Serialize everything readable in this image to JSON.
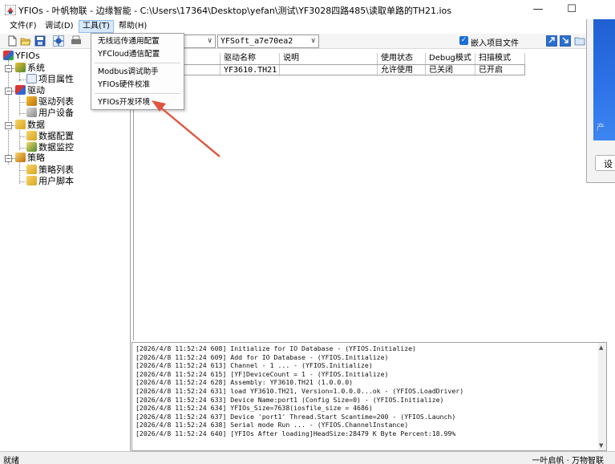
{
  "window": {
    "title": "YFIOs - 叶帆物联 - 边缘智能 - C:\\Users\\17364\\Desktop\\yefan\\测试\\YF3028四路485\\读取单路的TH21.ios",
    "minimize": "—",
    "maximize": "☐",
    "close": "✕"
  },
  "menubar": {
    "file": "文件(F)",
    "debug": "调试(D)",
    "tools": "工具(T)",
    "help": "帮助(H)"
  },
  "tools_menu": {
    "items": [
      "无线远传通用配置",
      "YFCloud通信配置",
      "Modbus调试助手",
      "YFIOs硬件校准",
      "YFIOs开发环境"
    ]
  },
  "toolbar": {
    "combo1": "",
    "combo2": "YFSoft_a7e70ea2",
    "embed_label": "嵌入项目文件",
    "embed_checked": true
  },
  "tree": {
    "root": "YFIOs",
    "system": "系统",
    "project_props": "项目属性",
    "drivers": "驱动",
    "driver_list": "驱动列表",
    "user_devices": "用户设备",
    "data": "数据",
    "data_config": "数据配置",
    "data_monitor": "数据监控",
    "strategy": "策略",
    "strategy_list": "策略列表",
    "user_script": "用户脚本"
  },
  "grid": {
    "columns": [
      "",
      "驱动名称",
      "说明",
      "使用状态",
      "Debug模式",
      "扫描模式"
    ],
    "rows": [
      [
        "",
        "YF3610.TH21",
        "",
        "允许使用",
        "已关闭",
        "已开启"
      ]
    ]
  },
  "log": [
    "[2026/4/8 11:52:24 608] Initialize for IO Database - (YFIOS.Initialize)",
    "[2026/4/8 11:52:24 609] Add for IO Database - (YFIOS.Initialize)",
    "[2026/4/8 11:52:24 613] Channel - 1 ... - (YFIOS.Initialize)",
    "[2026/4/8 11:52:24 615] [YF]DeviceCount = 1 - (YFIOS.Initialize)",
    "[2026/4/8 11:52:24 628] Assembly: YF3610.TH21 (1.0.0.0)",
    "[2026/4/8 11:52:24 631] load YF3610.TH21, Version=1.0.0.0...ok - (YFIOS.LoadDriver)",
    "[2026/4/8 11:52:24 633] Device Name:port1 (Config Size=0) - (YFIOS.Initialize)",
    "[2026/4/8 11:52:24 634] YFIOs_Size=7638(iosfile_size = 4686)",
    "[2026/4/8 11:52:24 637] Device 'port1' Thread.Start Scantime=200 - (YFIOS.Launch)",
    "[2026/4/8 11:52:24 638] Serial mode Run ... - (YFIOS.ChannelInstance)",
    "[2026/4/8 11:52:24 640] [YFIOs After loading]HeadSize:28479 K Byte Percent:18.99%"
  ],
  "status": {
    "left": "就绪",
    "right": "一叶启帆 · 万物智联"
  },
  "bg_window": {
    "button": "设"
  },
  "colors": {
    "menu_highlight": "#d7e8fb",
    "arrow": "#e0533d",
    "checkbox": "#1a6fd6"
  }
}
